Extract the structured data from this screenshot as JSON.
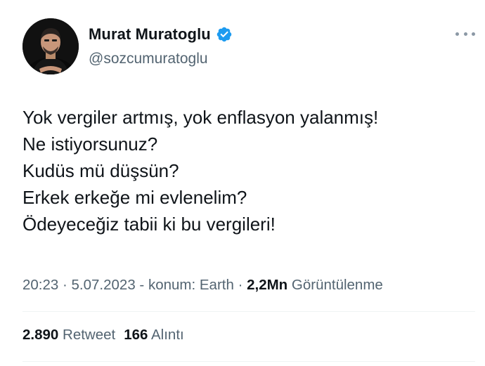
{
  "author": {
    "display_name": "Murat Muratoglu",
    "handle": "@sozcumuratoglu",
    "verified_color": "#1d9bf0"
  },
  "tweet": {
    "lines": [
      "Yok vergiler artmış, yok enflasyon yalanmış!",
      "Ne istiyorsunuz?",
      "Kudüs mü düşsün?",
      "Erkek erkeğe mi evlenelim?",
      "Ödeyeceğiz tabii ki bu vergileri!"
    ]
  },
  "meta": {
    "time": "20:23",
    "sep1": " · ",
    "date": "5.07.2023",
    "location": " - konum: Earth",
    "sep2": " · ",
    "views_count": "2,2Mn",
    "views_label": " Görüntülenme"
  },
  "stats": {
    "retweets_count": "2.890",
    "retweets_label": " Retweet",
    "quotes_count": "166",
    "quotes_label": " Alıntı"
  },
  "icons": {
    "more": "more-horizontal-icon",
    "verified": "verified-badge-icon"
  },
  "colors": {
    "text_primary": "#0f1419",
    "text_secondary": "#536471",
    "divider": "#eff3f4",
    "accent": "#1d9bf0"
  }
}
